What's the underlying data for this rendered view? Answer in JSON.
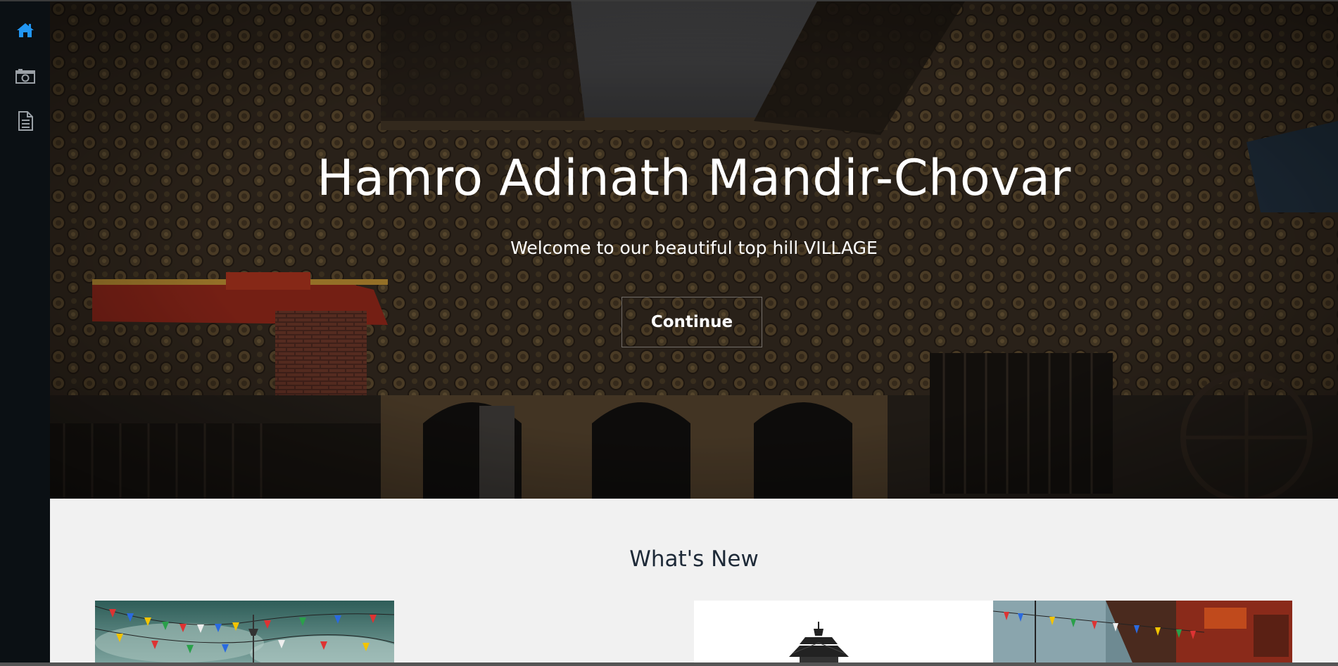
{
  "sidebar": {
    "items": [
      {
        "icon": "home-icon",
        "active": true
      },
      {
        "icon": "camera-icon",
        "active": false
      },
      {
        "icon": "document-icon",
        "active": false
      }
    ],
    "active_color": "#2196f3",
    "icon_color": "#9aa0a6"
  },
  "hero": {
    "title": "Hamro Adinath Mandir-Chovar",
    "subtitle": "Welcome to our beautiful top hill VILLAGE",
    "button_label": "Continue"
  },
  "news": {
    "title": "What's New",
    "cards": [
      {
        "image": "prayer-flags-sky-image"
      },
      {
        "image": "temple-black-white-image"
      },
      {
        "image": "prayer-flags-street-image"
      }
    ]
  }
}
